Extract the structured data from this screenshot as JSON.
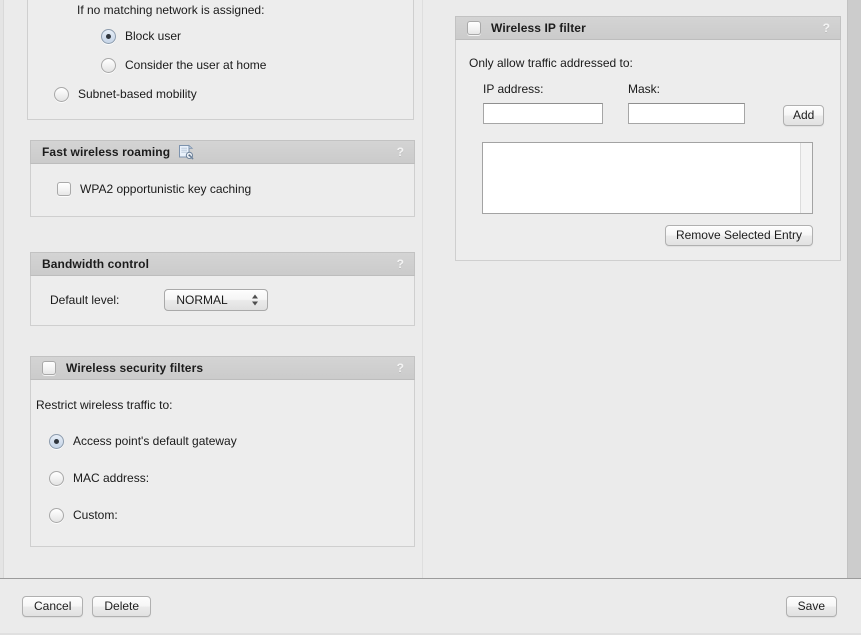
{
  "window": {
    "background": "#ebebeb",
    "panel_header_color": "#cfcfcf",
    "accent": "#c6d5e7"
  },
  "left_column": {
    "mobility_panel": {
      "intro_label": "If no matching network is assigned:",
      "options": [
        {
          "label": "Block user",
          "selected": true
        },
        {
          "label": "Consider the user at home",
          "selected": false
        }
      ],
      "subnet_option": {
        "label": "Subnet-based mobility",
        "selected": false
      }
    },
    "fast_roaming_panel": {
      "title": "Fast wireless roaming",
      "icon": "certificate-document-icon",
      "help": "?",
      "checkbox": {
        "label": "WPA2 opportunistic key caching",
        "checked": false
      }
    },
    "bandwidth_panel": {
      "title": "Bandwidth control",
      "help": "?",
      "level_label": "Default level:",
      "level_value": "NORMAL",
      "level_options": [
        "NORMAL"
      ]
    },
    "security_filters_panel": {
      "title": "Wireless security filters",
      "help": "?",
      "enabled": false,
      "restrict_label": "Restrict wireless traffic to:",
      "options": [
        {
          "label": "Access point's default gateway",
          "selected": true
        },
        {
          "label": "MAC address:",
          "selected": false
        },
        {
          "label": "Custom:",
          "selected": false
        }
      ]
    }
  },
  "right_column": {
    "ip_filter_panel": {
      "title": "Wireless IP filter",
      "help": "?",
      "enabled": false,
      "intro_label": "Only allow traffic addressed to:",
      "ip_label": "IP address:",
      "ip_value": "",
      "ip_placeholder": "",
      "mask_label": "Mask:",
      "mask_value": "",
      "mask_placeholder": "",
      "add_button": "Add",
      "entries": [],
      "remove_button": "Remove Selected Entry"
    }
  },
  "footer": {
    "cancel_button": "Cancel",
    "delete_button": "Delete",
    "save_button": "Save"
  }
}
